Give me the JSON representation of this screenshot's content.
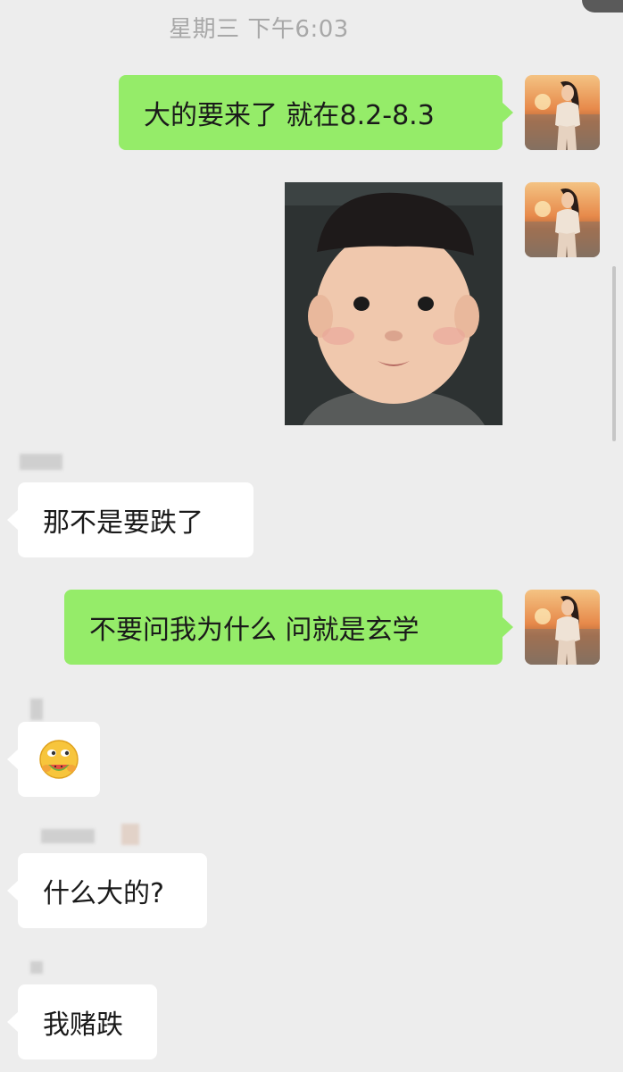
{
  "timestamp": "星期三 下午6:03",
  "messages": [
    {
      "from": "me",
      "type": "text",
      "text": "大的要来了 就在8.2-8.3"
    },
    {
      "from": "me",
      "type": "sticker",
      "sticker": "child-face-sticker"
    },
    {
      "from": "other",
      "type": "text",
      "text": "那不是要跌了"
    },
    {
      "from": "me",
      "type": "text",
      "text": "不要问我为什么 问就是玄学"
    },
    {
      "from": "other",
      "type": "emoji",
      "emoji": "melon-eating-emoji"
    },
    {
      "from": "other",
      "type": "text",
      "text": "什么大的?"
    },
    {
      "from": "other",
      "type": "text",
      "text": "我赌跌"
    }
  ],
  "colors": {
    "background": "#ededed",
    "my_bubble": "#95ec69",
    "their_bubble": "#ffffff",
    "timestamp_text": "#a8a8a8"
  }
}
